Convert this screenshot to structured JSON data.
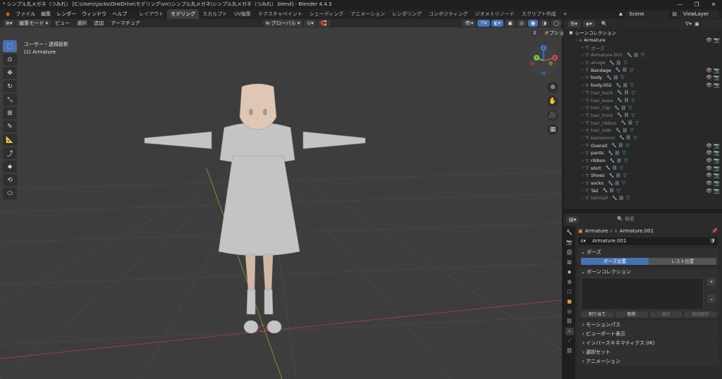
{
  "window": {
    "title": "* シンプル丸メガネ（つみれ） [C:\\Users\\jacks\\OneDrive\\モデリング\\vrc\\シンプル丸メガネ\\シンプル丸メガネ（つみれ）.blend] - Blender 4.4.3",
    "minimize": "—",
    "maximize": "❐",
    "close": "✕"
  },
  "menubar": {
    "menus": [
      "ファイル",
      "編集",
      "レンダー",
      "ウィンドウ",
      "ヘルプ"
    ],
    "workspaces": [
      "レイアウト",
      "モデリング",
      "スカルプト",
      "UV編集",
      "テクスチャペイント",
      "シェーディング",
      "アニメーション",
      "レンダリング",
      "コンポジティング",
      "ジオメトリノード",
      "スクリプト作成"
    ],
    "active_workspace": "モデリング",
    "add_tab": "+",
    "scene": "Scene",
    "view_layer": "ViewLayer"
  },
  "viewport_header": {
    "mode": "編集モード",
    "menus": [
      "ビュー",
      "選択",
      "追加",
      "アーマチュア"
    ],
    "orientation": "グローバル",
    "options": "オプション",
    "close_x": "X"
  },
  "viewport": {
    "view_name": "ユーザー・透視投影",
    "object_info": "(1) Armature"
  },
  "tools": [
    "select-box-icon",
    "cursor-icon",
    "move-icon",
    "rotate-icon",
    "scale-icon",
    "transform-icon",
    "annotate-icon",
    "measure-icon",
    "extrude-icon",
    "bone-size-icon",
    "roll-icon",
    "bone-envelope-icon"
  ],
  "gizmo": {
    "x": "X",
    "y": "Y",
    "z": "Z"
  },
  "outliner": {
    "title": "シーンコレクション",
    "rows": [
      {
        "name": "Armature",
        "dim": false,
        "indent": 1
      },
      {
        "name": "ポーズ",
        "dim": true,
        "indent": 2
      },
      {
        "name": "Armature.001",
        "dim": true,
        "indent": 2
      },
      {
        "name": "ahoge",
        "dim": true,
        "indent": 2
      },
      {
        "name": "Bandage",
        "dim": false,
        "indent": 2
      },
      {
        "name": "body",
        "dim": false,
        "indent": 2
      },
      {
        "name": "body.002",
        "dim": false,
        "indent": 2
      },
      {
        "name": "hair_back",
        "dim": true,
        "indent": 2
      },
      {
        "name": "hair_base",
        "dim": true,
        "indent": 2
      },
      {
        "name": "hair_clip",
        "dim": true,
        "indent": 2
      },
      {
        "name": "hair_front",
        "dim": true,
        "indent": 2
      },
      {
        "name": "hair_ribbon",
        "dim": true,
        "indent": 2
      },
      {
        "name": "hair_side",
        "dim": true,
        "indent": 2
      },
      {
        "name": "kemomimi",
        "dim": true,
        "indent": 2
      },
      {
        "name": "Overall",
        "dim": false,
        "indent": 2
      },
      {
        "name": "pants",
        "dim": false,
        "indent": 2
      },
      {
        "name": "ribbon",
        "dim": false,
        "indent": 2
      },
      {
        "name": "shirt",
        "dim": false,
        "indent": 2
      },
      {
        "name": "Shoes",
        "dim": false,
        "indent": 2
      },
      {
        "name": "socks",
        "dim": false,
        "indent": 2
      },
      {
        "name": "Tail",
        "dim": false,
        "indent": 2
      },
      {
        "name": "twintail",
        "dim": true,
        "indent": 2
      }
    ]
  },
  "properties": {
    "search_placeholder": "検索",
    "path_armature": "Armature",
    "path_data": "Armature.001",
    "name_field": "Armature.001",
    "pose_panel": "ポーズ",
    "pose_position": "ポーズ位置",
    "rest_position": "レスト位置",
    "bone_collection_panel": "ボーンコレクション",
    "assign": "割り当て",
    "remove": "削除",
    "select": "選択",
    "deselect": "選択解除",
    "collapsed_panels": [
      "モーションパス",
      "ビューポート表示",
      "インバースキネマティクス (IK)",
      "選択セット",
      "アニメーション"
    ]
  },
  "colors": {
    "accent": "#4772b3",
    "grid": "#484848",
    "x_axis": "#a33b47",
    "y_axis": "#6e9a2e"
  }
}
